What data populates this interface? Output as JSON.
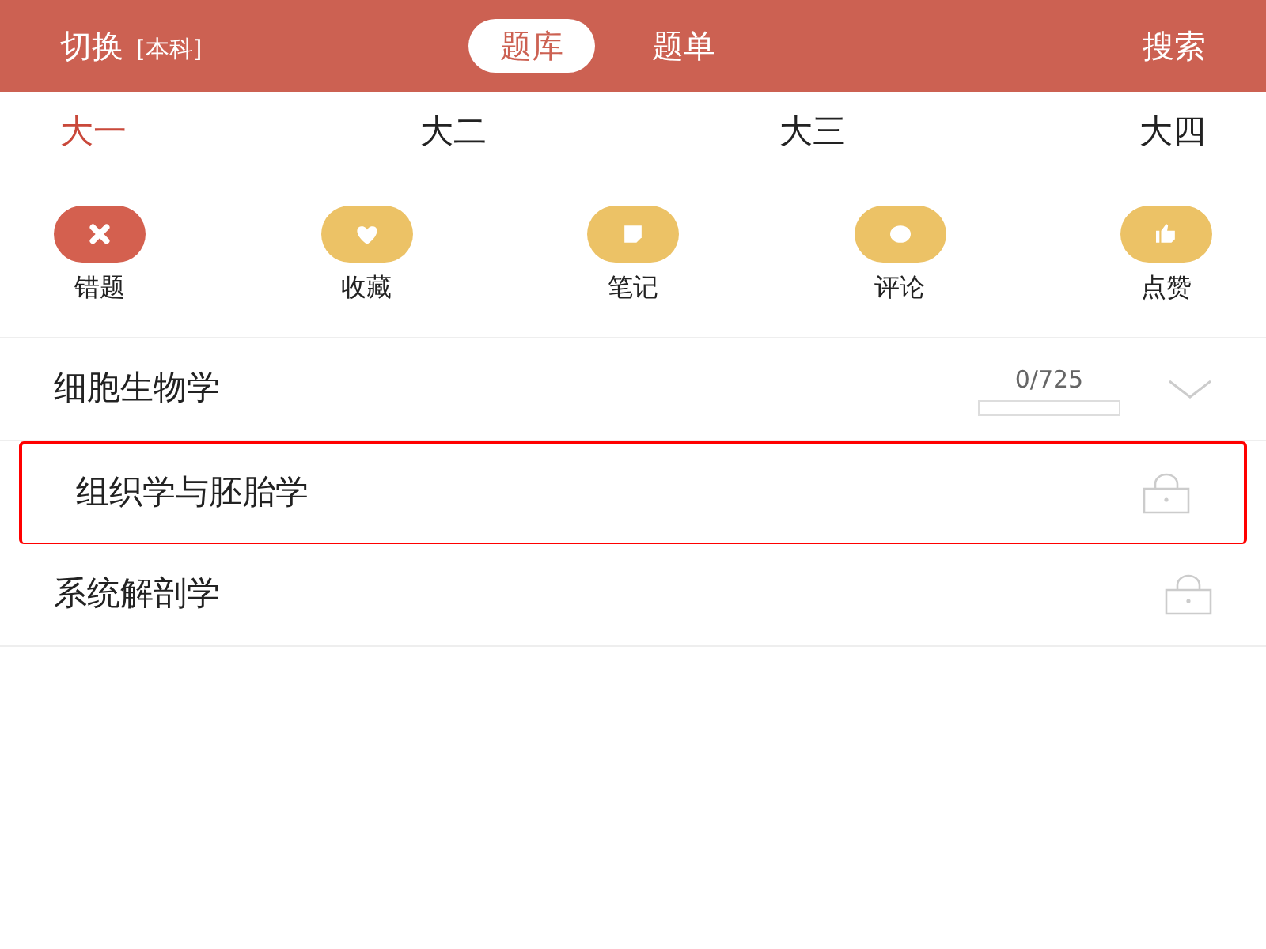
{
  "header": {
    "switch_label": "切换",
    "level_tag": "[本科]",
    "tabs": [
      {
        "label": "题库",
        "selected": true
      },
      {
        "label": "题单",
        "selected": false
      }
    ],
    "search_label": "搜索"
  },
  "years": [
    {
      "label": "大一",
      "selected": true
    },
    {
      "label": "大二",
      "selected": false
    },
    {
      "label": "大三",
      "selected": false
    },
    {
      "label": "大四",
      "selected": false
    }
  ],
  "shortcuts": [
    {
      "label": "错题",
      "kind": "wrong"
    },
    {
      "label": "收藏",
      "kind": "favorite"
    },
    {
      "label": "笔记",
      "kind": "note"
    },
    {
      "label": "评论",
      "kind": "comment"
    },
    {
      "label": "点赞",
      "kind": "like"
    }
  ],
  "subjects": [
    {
      "name": "细胞生物学",
      "kind": "progress",
      "count": "0/725",
      "level": 0,
      "highlighted": false
    },
    {
      "name": "组织学与胚胎学",
      "kind": "locked",
      "highlighted": true
    },
    {
      "name": "系统解剖学",
      "kind": "locked",
      "highlighted": false
    }
  ]
}
